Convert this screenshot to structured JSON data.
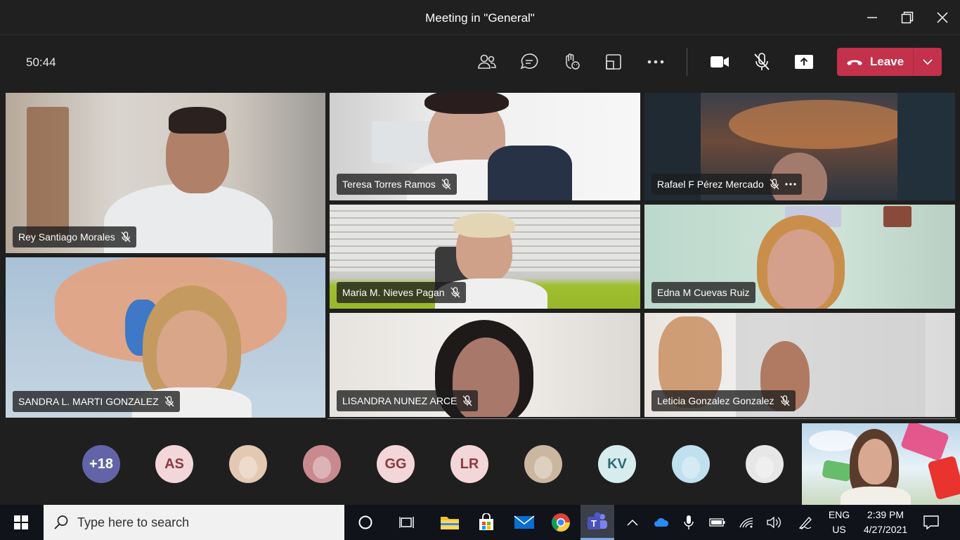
{
  "window": {
    "title": "Meeting in \"General\""
  },
  "toolbar": {
    "timer": "50:44",
    "leave_label": "Leave"
  },
  "participants": [
    {
      "name": "Rey Santiago Morales"
    },
    {
      "name": "SANDRA L. MARTI GONZALEZ"
    },
    {
      "name": "Teresa Torres Ramos"
    },
    {
      "name": "Rafael F Pérez Mercado"
    },
    {
      "name": "Maria M. Nieves Pagan"
    },
    {
      "name": "Edna M Cuevas Ruiz"
    },
    {
      "name": "LISANDRA NUNEZ ARCE"
    },
    {
      "name": "Leticia Gonzalez Gonzalez"
    }
  ],
  "overflow": {
    "more_count": "+18",
    "avatars": [
      {
        "initials": "AS",
        "bg": "#f3d6d8",
        "fg": "#8a3a43"
      },
      {
        "initials": "",
        "bg": "#e4c9b2",
        "fg": "#000000"
      },
      {
        "initials": "",
        "bg": "#c98a8f",
        "fg": "#000000"
      },
      {
        "initials": "GG",
        "bg": "#f3d6d8",
        "fg": "#8a3a43"
      },
      {
        "initials": "LR",
        "bg": "#f3d6d8",
        "fg": "#8a3a43"
      },
      {
        "initials": "",
        "bg": "#cbb7a0",
        "fg": "#000000"
      },
      {
        "initials": "KV",
        "bg": "#d6ecef",
        "fg": "#2c6b73"
      },
      {
        "initials": "",
        "bg": "#bfe0ef",
        "fg": "#000000"
      },
      {
        "initials": "",
        "bg": "#e7e7e7",
        "fg": "#000000"
      }
    ]
  },
  "taskbar": {
    "search_placeholder": "Type here to search",
    "language_top": "ENG",
    "language_bottom": "US",
    "time": "2:39 PM",
    "date": "4/27/2021"
  },
  "colors": {
    "leave": "#c4314b",
    "more_badge": "#6264a7",
    "title_bg": "#202020",
    "stage_bg": "#1f1f1f"
  }
}
